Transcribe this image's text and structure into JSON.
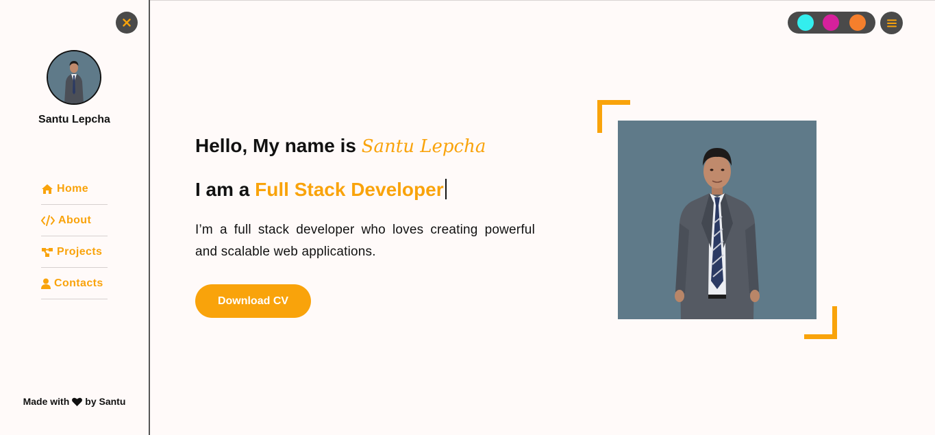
{
  "sidebar": {
    "profile_name": "Santu Lepcha",
    "nav": [
      {
        "label": "Home",
        "icon": "home-icon"
      },
      {
        "label": "About",
        "icon": "code-icon"
      },
      {
        "label": "Projects",
        "icon": "project-diagram-icon"
      },
      {
        "label": "Contacts",
        "icon": "user-icon"
      }
    ],
    "footer": {
      "prefix": "Made with",
      "suffix": "by Santu",
      "icon": "heart-icon"
    }
  },
  "theme_colors": [
    "#33eeee",
    "#d6219c",
    "#f57f2c"
  ],
  "accent_color": "#f9a30b",
  "hero": {
    "greeting": "Hello, My name is",
    "name": "Santu Lepcha",
    "role_prefix": "I am a",
    "role": "Full Stack Developer",
    "description": "I’m a full stack developer who loves creating powerful and scalable web applications.",
    "cta_label": "Download CV"
  }
}
